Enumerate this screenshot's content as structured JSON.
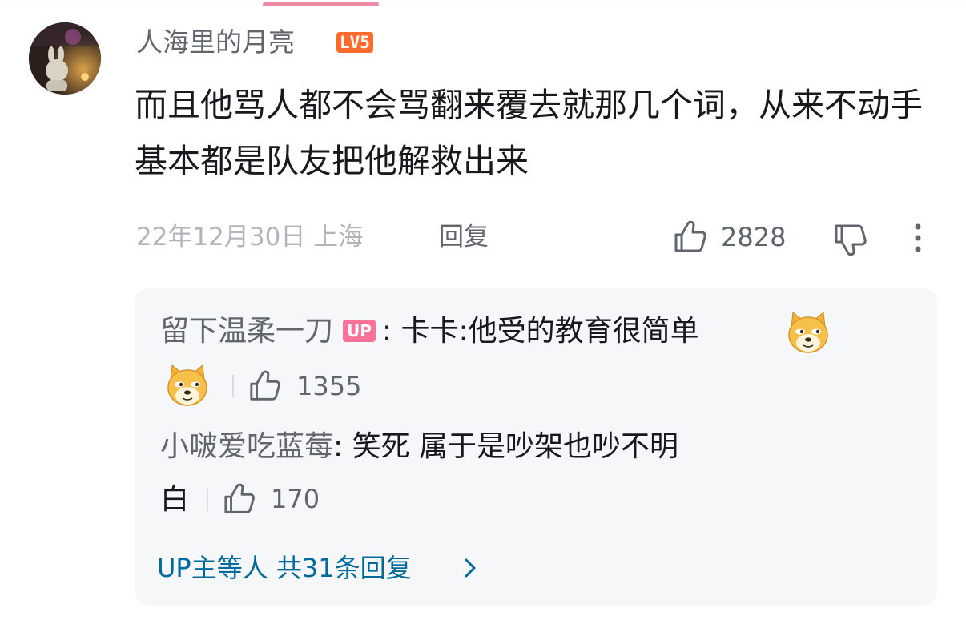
{
  "comment": {
    "username": "人海里的月亮",
    "level": "LV5",
    "text": "而且他骂人都不会骂翻来覆去就那几个词，从来不动手基本都是队友把他解救出来",
    "date": "22年12月30日 上海",
    "reply_label": "回复",
    "like_count": "2828"
  },
  "replies": [
    {
      "name": "留下温柔一刀",
      "badge": "UP",
      "colon": ":",
      "text": "卡卡:他受的教育很简单",
      "like_count": "1355"
    },
    {
      "name": "小啵爱吃蓝莓",
      "colon": ":",
      "text": "笑死 属于是吵架也吵不明",
      "text_cont": "白",
      "like_count": "170"
    }
  ],
  "view_all": "UP主等人 共31条回复",
  "colors": {
    "link": "#00699d",
    "up_badge": "#fb7299",
    "level_badge": "#ff6b2c",
    "meta_gray": "#b1b5bb",
    "reply_box": "#f6f7f8"
  },
  "icons": [
    "thumbs-up-icon",
    "thumbs-down-icon",
    "more-vertical-icon",
    "doge-emoji",
    "chevron-right-icon"
  ]
}
